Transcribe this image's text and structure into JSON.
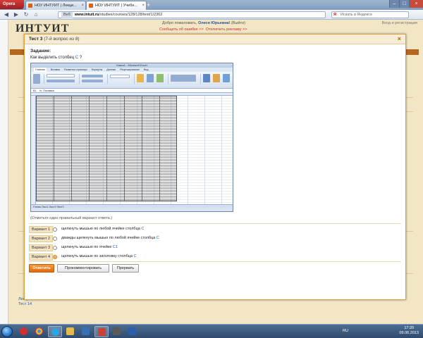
{
  "browser": {
    "opera_label": "Opera",
    "tabs": [
      {
        "label": "НОУ ИНТУИТ | Лекци..."
      },
      {
        "label": "НОУ ИНТУИТ | Учебн..."
      }
    ],
    "url_badge": "Веб",
    "url_domain": "www.intuit.ru",
    "url_path": "/studies/courses/128/128/test/1/2362",
    "search_placeholder": "Искать в Яндексе"
  },
  "page": {
    "logo": "ИНТУИТ",
    "welcome": "Добро пожаловать,",
    "user": "Олеся Юрьевна!",
    "logout": "(Выйти)",
    "report_error": "Сообщить об ошибке >>",
    "disable_ads": "Отключить рекламу >>",
    "right_link": "Вход и регистрация",
    "bottom_links": [
      "Лекция 14",
      "Тест 14"
    ]
  },
  "dialog": {
    "title": "Тест 3",
    "subtitle": "(7-й вопрос из 8)",
    "task_label": "Задание:",
    "question": "Как выделить столбец",
    "question_cell": "C",
    "question_suffix": "?",
    "excel": {
      "title": "Книга1 - Microsoft Excel",
      "tabs": [
        "Главная",
        "Вставка",
        "Разметка страницы",
        "Формулы",
        "Данные",
        "Рецензирование",
        "Вид"
      ],
      "name_box": "B1",
      "formula": "Поставка",
      "status": "Готово   Лист1  Лист2  Лист3"
    },
    "hint": "(Отметьте один правильный вариант ответа.)",
    "options": [
      {
        "label": "Вариант 1",
        "text": "щелкнуть мышью по любой ячейке столбца",
        "cell": "C",
        "checked": false
      },
      {
        "label": "Вариант 2",
        "text": "дважды щелкнуть мышью по любой ячейке столбца",
        "cell": "C",
        "checked": false
      },
      {
        "label": "Вариант 3",
        "text": "щелкнуть мышью по ячейке",
        "cell": "C1",
        "checked": false
      },
      {
        "label": "Вариант 4",
        "text": "щелкнуть мышью по заголовку столбца",
        "cell": "C",
        "checked": true
      }
    ],
    "buttons": {
      "answer": "Ответить",
      "comment": "Прокомментировать",
      "skip": "Прервать"
    }
  },
  "taskbar": {
    "lang": "RU",
    "time": "17:20",
    "date": "09.06.2013"
  }
}
